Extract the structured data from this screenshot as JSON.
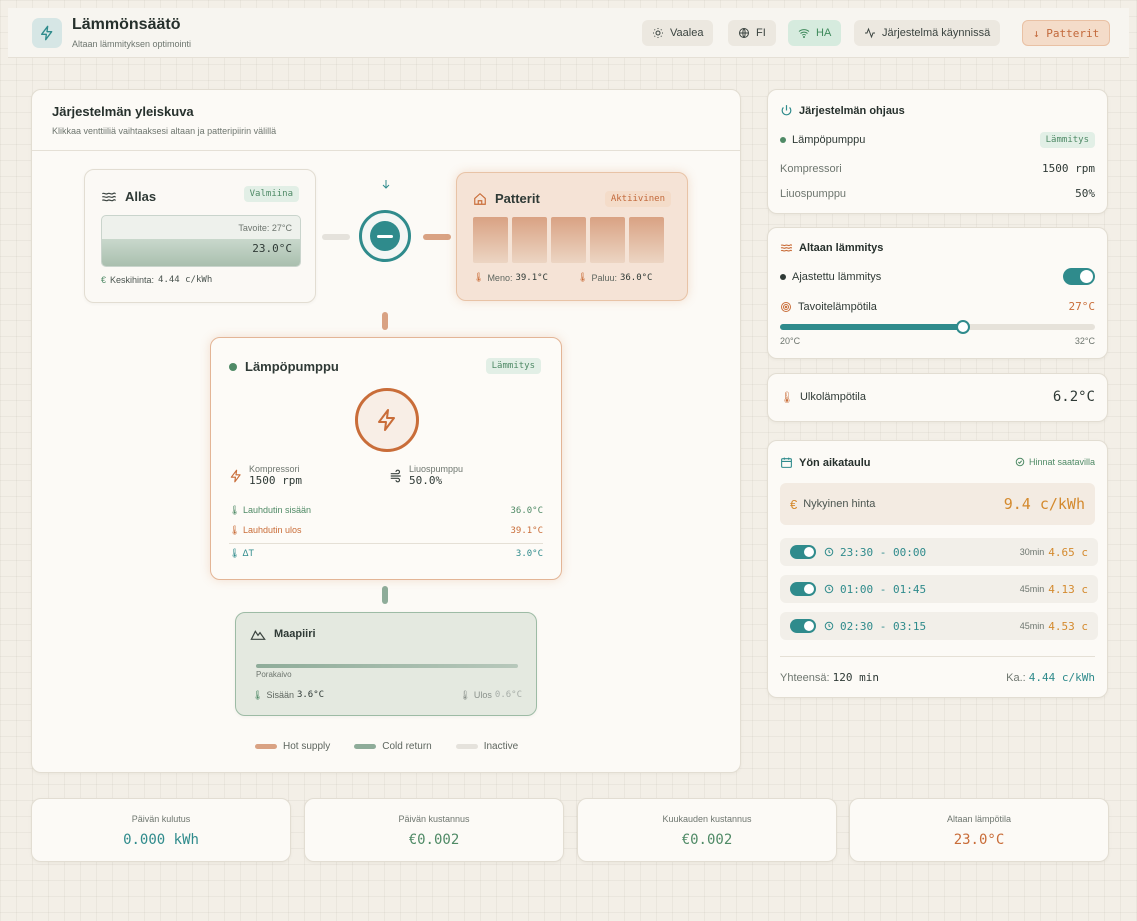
{
  "header": {
    "title": "Lämmönsäätö",
    "subtitle": "Altaan lämmityksen optimointi",
    "theme_btn": "Vaalea",
    "lang_btn": "FI",
    "ha_btn": "HA",
    "status_btn": "Järjestelmä käynnissä",
    "mode_btn": "↓ Patterit"
  },
  "overview": {
    "title": "Järjestelmän yleiskuva",
    "subtitle": "Klikkaa venttiiliä vaihtaaksesi altaan ja patteripiirin välillä",
    "pool": {
      "title": "Allas",
      "badge": "Valmiina",
      "target": "Tavoite: 27°C",
      "temp": "23.0°C",
      "fill_level": 0.55,
      "avg_price_label": "Keskihinta:",
      "avg_price": "4.44 c/kWh"
    },
    "radiators": {
      "title": "Patterit",
      "badge": "Aktiivinen",
      "supply_label": "Meno:",
      "supply": "39.1°C",
      "return_label": "Paluu:",
      "return": "36.0°C"
    },
    "heatpump": {
      "title": "Lämpöpumppu",
      "badge": "Lämmitys",
      "compressor_label": "Kompressori",
      "compressor": "1500 rpm",
      "brine_label": "Liuospumppu",
      "brine": "50.0%",
      "cond_in_label": "Lauhdutin sisään",
      "cond_in": "36.0°C",
      "cond_out_label": "Lauhdutin ulos",
      "cond_out": "39.1°C",
      "delta_label": "ΔT",
      "delta": "3.0°C"
    },
    "ground": {
      "title": "Maapiiri",
      "well_label": "Porakaivo",
      "in_label": "Sisään",
      "in": "3.6°C",
      "out_label": "Ulos",
      "out": "0.6°C"
    },
    "legend": {
      "hot": "Hot supply",
      "cold": "Cold return",
      "inactive": "Inactive"
    },
    "colors": {
      "hot": "#d9a283",
      "cold": "#8eac99",
      "inactive": "#e5e2dc",
      "teal": "#2f8b8c",
      "orange": "#c96d39"
    }
  },
  "control": {
    "title": "Järjestelmän ohjaus",
    "heatpump_label": "Lämpöpumppu",
    "heatpump_badge": "Lämmitys",
    "compressor_label": "Kompressori",
    "compressor": "1500 rpm",
    "brine_label": "Liuospumppu",
    "brine": "50%"
  },
  "pool_heating": {
    "title": "Altaan lämmitys",
    "scheduled_label": "Ajastettu lämmitys",
    "scheduled_on": true,
    "target_label": "Tavoitelämpötila",
    "target": "27°C",
    "target_value": 27,
    "min": "20°C",
    "max": "32°C",
    "slider_fraction": 0.58
  },
  "outdoor": {
    "label": "Ulkolämpötila",
    "value": "6.2°C"
  },
  "schedule": {
    "title": "Yön aikataulu",
    "prices_status": "Hinnat saatavilla",
    "current_price_label": "Nykyinen hinta",
    "current_price": "9.4 c/kWh",
    "slots": [
      {
        "time": "23:30 - 00:00",
        "duration": "30min",
        "price": "4.65 c"
      },
      {
        "time": "01:00 - 01:45",
        "duration": "45min",
        "price": "4.13 c"
      },
      {
        "time": "02:30 - 03:15",
        "duration": "45min",
        "price": "4.53 c"
      }
    ],
    "total_label": "Yhteensä:",
    "total": "120 min",
    "avg_label": "Ka.:",
    "avg": "4.44 c/kWh"
  },
  "stats": [
    {
      "label": "Päivän kulutus",
      "value": "0.000 kWh"
    },
    {
      "label": "Päivän kustannus",
      "value": "€0.002"
    },
    {
      "label": "Kuukauden kustannus",
      "value": "€0.002"
    },
    {
      "label": "Altaan lämpötila",
      "value": "23.0°C"
    }
  ]
}
